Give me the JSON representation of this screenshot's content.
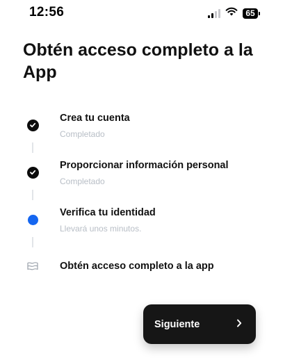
{
  "status_bar": {
    "time": "12:56",
    "battery_level": "65",
    "signal_bars_active": 2,
    "signal_bars_total": 4,
    "icons": [
      "signal-icon",
      "wifi-icon",
      "battery-icon"
    ]
  },
  "header": {
    "title": "Obtén acceso completo a la App"
  },
  "steps": [
    {
      "title": "Crea tu cuenta",
      "subtitle": "Completado",
      "state": "completed",
      "icon": "checkmark-circle-icon"
    },
    {
      "title": "Proporcionar información personal",
      "subtitle": "Completado",
      "state": "completed",
      "icon": "checkmark-circle-icon"
    },
    {
      "title": "Verifica tu identidad",
      "subtitle": "Llevará unos minutos.",
      "state": "active",
      "icon": "blue-dot-icon"
    },
    {
      "title": "Obtén acceso completo a la app",
      "state": "pending",
      "icon": "flag-icon"
    }
  ],
  "footer": {
    "next_label": "Siguiente",
    "next_icon": "chevron-right-icon"
  },
  "colors": {
    "accent": "#1566f0",
    "button_bg": "#161616",
    "subtitle": "#b8bec6"
  }
}
